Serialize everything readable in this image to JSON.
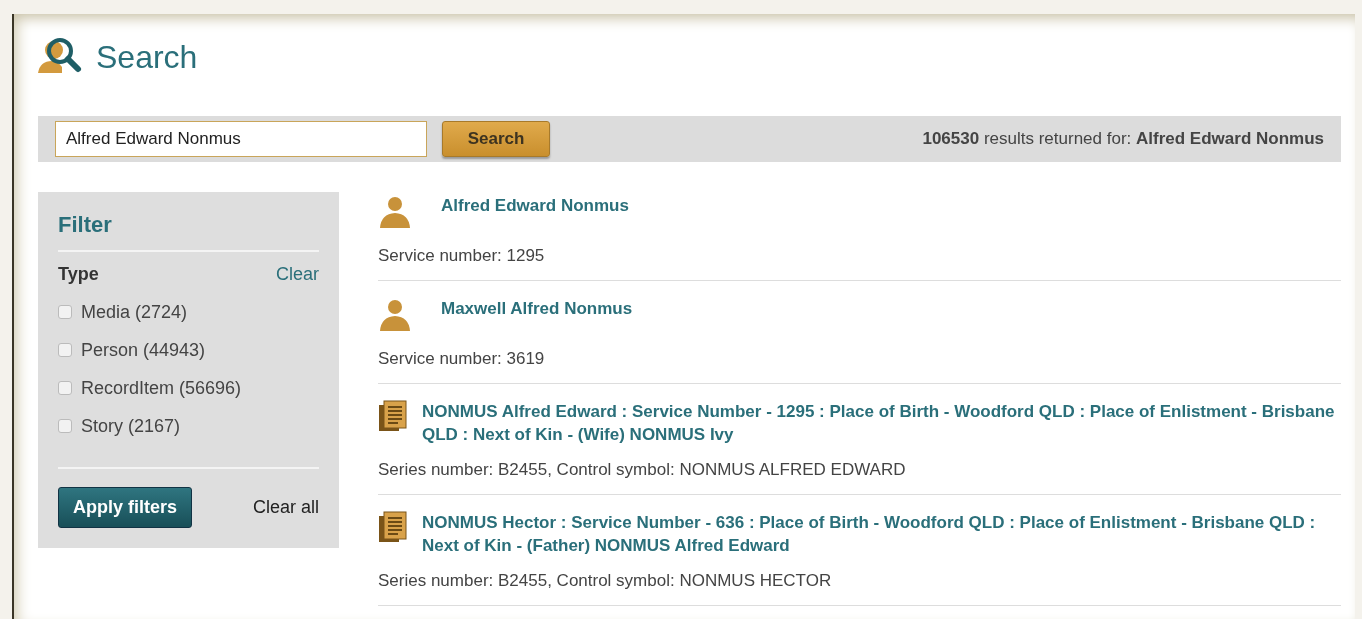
{
  "page": {
    "title": "Search"
  },
  "search": {
    "value": "Alfred Edward Nonmus",
    "button": "Search",
    "count": "106530",
    "count_text": "results returned for:",
    "query": "Alfred Edward Nonmus"
  },
  "filter": {
    "title": "Filter",
    "group": "Type",
    "clear": "Clear",
    "options": [
      {
        "label": "Media (2724)",
        "checked": false
      },
      {
        "label": "Person (44943)",
        "checked": false
      },
      {
        "label": "RecordItem (56696)",
        "checked": false
      },
      {
        "label": "Story (2167)",
        "checked": false
      }
    ],
    "apply": "Apply filters",
    "clear_all": "Clear all"
  },
  "results": [
    {
      "kind": "person",
      "title": "Alfred Edward Nonmus",
      "detail": "Service number: 1295"
    },
    {
      "kind": "person",
      "title": "Maxwell Alfred Nonmus",
      "detail": "Service number: 3619"
    },
    {
      "kind": "record",
      "title": "NONMUS Alfred Edward : Service Number - 1295 : Place of Birth - Woodford QLD : Place of Enlistment - Brisbane QLD : Next of Kin - (Wife) NONMUS Ivy",
      "detail": "Series number: B2455, Control symbol: NONMUS ALFRED EDWARD"
    },
    {
      "kind": "record",
      "title": "NONMUS Hector : Service Number - 636 : Place of Birth - Woodford QLD : Place of Enlistment - Brisbane QLD : Next of Kin - (Father) NONMUS Alfred Edward",
      "detail": "Series number: B2455, Control symbol: NONMUS HECTOR"
    }
  ]
}
